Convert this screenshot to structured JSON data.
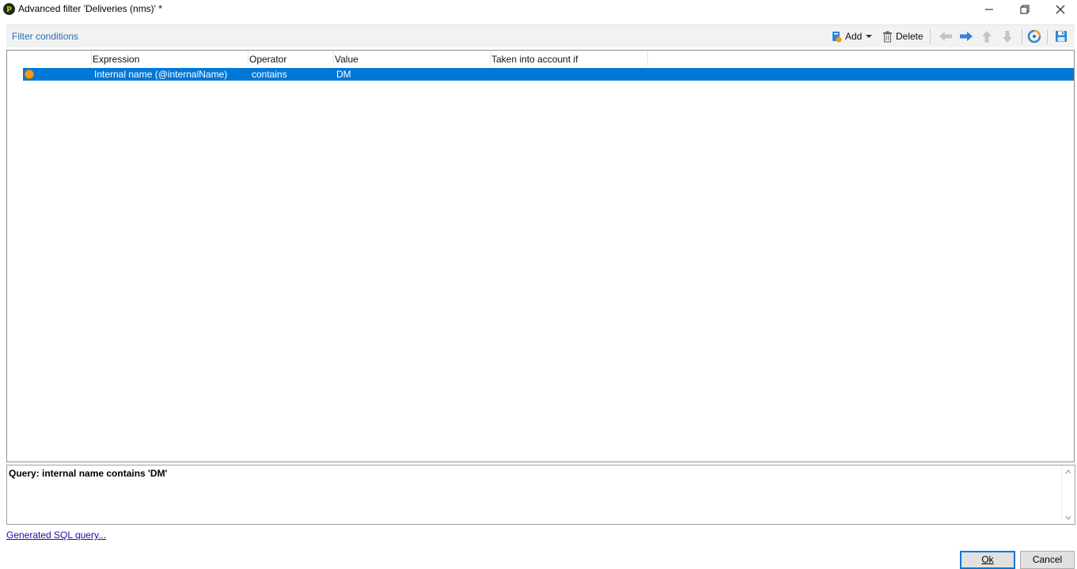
{
  "window": {
    "title": "Advanced filter 'Deliveries (nms)' *",
    "app_icon_letter": "p",
    "controls": {
      "minimize": "—",
      "restore": "❐",
      "close": "✕"
    }
  },
  "toolbar": {
    "section_title": "Filter conditions",
    "add_label": "Add",
    "delete_label": "Delete",
    "icons": [
      "add-icon",
      "dropdown-arrow-icon",
      "trash-icon",
      "arrow-left-icon",
      "arrow-right-icon",
      "arrow-up-icon",
      "arrow-down-icon",
      "refresh-icon",
      "save-icon"
    ]
  },
  "grid": {
    "columns": [
      "Expression",
      "Operator",
      "Value",
      "Taken into account if"
    ],
    "rows": [
      {
        "expression": "Internal name (@internalName)",
        "operator": "contains",
        "value": "DM",
        "condition": "",
        "selected": true
      }
    ]
  },
  "query": {
    "text": "Query: internal name contains 'DM'"
  },
  "footer": {
    "sql_link": "Generated SQL query...",
    "ok_label": "Ok",
    "cancel_label": "Cancel"
  },
  "colors": {
    "accent": "#0078d7",
    "section_title": "#2a6eb3",
    "marker": "#f29a19",
    "arrow_enabled": "#2f86d6",
    "arrow_disabled": "#c4c4c4"
  }
}
